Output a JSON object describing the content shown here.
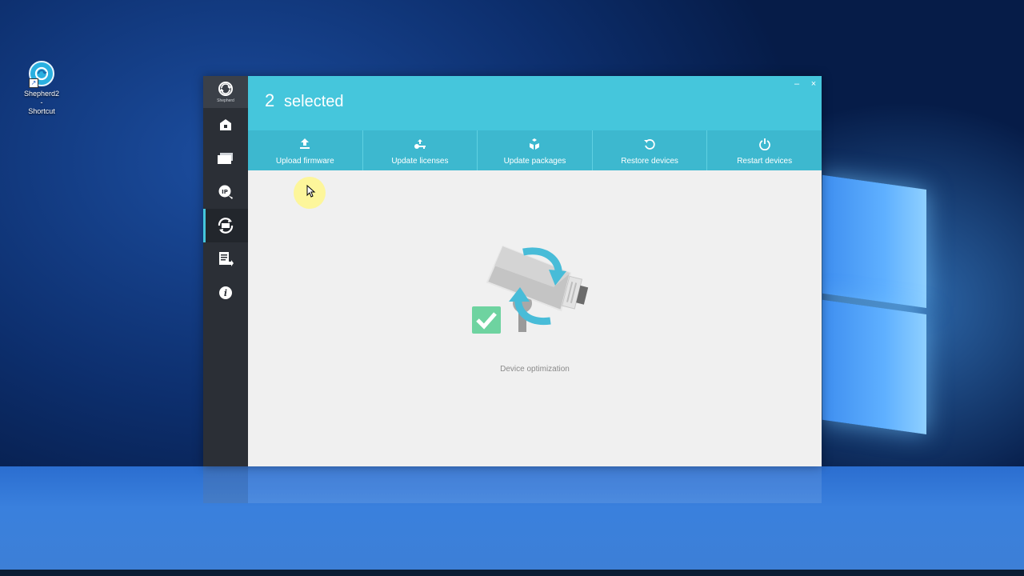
{
  "desktop": {
    "shortcut": {
      "icon": "shepherd-icon",
      "label_line1": "Shepherd2 -",
      "label_line2": "Shortcut"
    }
  },
  "app": {
    "logo": {
      "icon": "shepherd-logo-icon",
      "text": "Shepherd"
    },
    "sidebar": {
      "items": [
        {
          "icon": "home-icon",
          "active": false
        },
        {
          "icon": "devices-icon",
          "active": false
        },
        {
          "icon": "ip-settings-icon",
          "active": false
        },
        {
          "icon": "maintenance-icon",
          "active": true
        },
        {
          "icon": "export-report-icon",
          "active": false
        },
        {
          "icon": "info-icon",
          "active": false
        }
      ]
    },
    "header": {
      "count": "2",
      "selected_label": "selected",
      "minimize_label": "–",
      "close_label": "×"
    },
    "toolbar": {
      "buttons": [
        {
          "label": "Upload firmware",
          "icon": "upload-icon"
        },
        {
          "label": "Update licenses",
          "icon": "key-icon"
        },
        {
          "label": "Update packages",
          "icon": "packages-icon"
        },
        {
          "label": "Restore devices",
          "icon": "restore-icon"
        },
        {
          "label": "Restart devices",
          "icon": "power-icon"
        }
      ]
    },
    "content": {
      "illustration": "device-optimization-illustration",
      "caption": "Device optimization"
    }
  },
  "colors": {
    "header": "#45c6dc",
    "toolbar": "#3db8cf",
    "sidebar": "#2b2f36",
    "content_bg": "#f0f0f0"
  }
}
